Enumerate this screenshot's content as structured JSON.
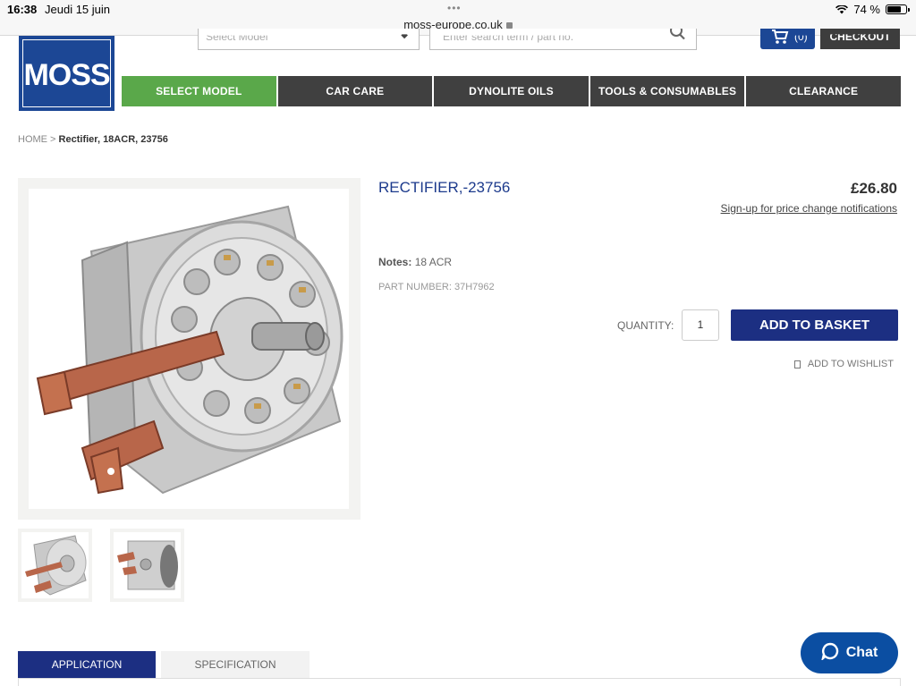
{
  "status_bar": {
    "time": "16:38",
    "date": "Jeudi 15 juin",
    "url": "moss-europe.co.uk",
    "battery": "74 %",
    "battery_level": 0.74
  },
  "header": {
    "logo_text": "MOSS",
    "select_model_placeholder": "Select Model",
    "search_placeholder": "Enter search term / part no.",
    "cart_count": "(0)",
    "checkout_label": "CHECKOUT"
  },
  "nav": [
    {
      "label": "SELECT MODEL"
    },
    {
      "label": "CAR CARE"
    },
    {
      "label": "DYNOLITE OILS"
    },
    {
      "label": "TOOLS & CONSUMABLES"
    },
    {
      "label": "CLEARANCE"
    }
  ],
  "breadcrumb": {
    "home": "HOME",
    "separator": " > ",
    "current": "Rectifier, 18ACR, 23756"
  },
  "product": {
    "title": "RECTIFIER,-23756",
    "price": "£26.80",
    "price_link": "Sign-up for price change notifications",
    "notes_label": "Notes:",
    "notes_value": "18 ACR",
    "part_number": "PART NUMBER: 37H7962",
    "quantity_label": "QUANTITY:",
    "quantity_value": "1",
    "add_to_basket": "ADD TO BASKET",
    "wishlist": "ADD TO WISHLIST"
  },
  "tabs": [
    {
      "label": "APPLICATION",
      "active": true
    },
    {
      "label": "SPECIFICATION",
      "active": false
    }
  ],
  "chat": {
    "label": "Chat"
  },
  "colors": {
    "brand_blue": "#1c4795",
    "button_blue": "#1c2f82",
    "nav_dark": "#404040",
    "nav_green": "#5aa84a",
    "chat_blue": "#0b4ea2"
  }
}
